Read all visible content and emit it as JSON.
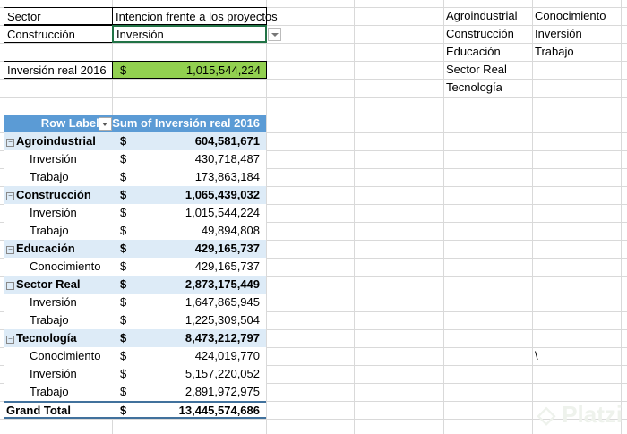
{
  "top": {
    "sector_label": "Sector",
    "intention_label": "Intencion frente a los proyectos",
    "sector_value": "Construcción",
    "intention_value": "Inversión",
    "result_label": "Inversión real 2016",
    "result_currency": "$",
    "result_value": "1,015,544,224"
  },
  "lists": {
    "sectors": [
      "Agroindustrial",
      "Construcción",
      "Educación",
      "Sector Real",
      "Tecnología"
    ],
    "intentions": [
      "Conocimiento",
      "Inversión",
      "Trabajo"
    ]
  },
  "stray_char": "\\",
  "pivot": {
    "header_rows": "Row Labels",
    "header_values": "Sum of Inversión real 2016",
    "rows": [
      {
        "label": "Agroindustrial",
        "currency": "$",
        "value": "604,581,671",
        "type": "group"
      },
      {
        "label": "Inversión",
        "currency": "$",
        "value": "430,718,487",
        "type": "item"
      },
      {
        "label": "Trabajo",
        "currency": "$",
        "value": "173,863,184",
        "type": "item"
      },
      {
        "label": "Construcción",
        "currency": "$",
        "value": "1,065,439,032",
        "type": "group"
      },
      {
        "label": "Inversión",
        "currency": "$",
        "value": "1,015,544,224",
        "type": "item"
      },
      {
        "label": "Trabajo",
        "currency": "$",
        "value": "49,894,808",
        "type": "item"
      },
      {
        "label": "Educación",
        "currency": "$",
        "value": "429,165,737",
        "type": "group"
      },
      {
        "label": "Conocimiento",
        "currency": "$",
        "value": "429,165,737",
        "type": "item"
      },
      {
        "label": "Sector Real",
        "currency": "$",
        "value": "2,873,175,449",
        "type": "group"
      },
      {
        "label": "Inversión",
        "currency": "$",
        "value": "1,647,865,945",
        "type": "item"
      },
      {
        "label": "Trabajo",
        "currency": "$",
        "value": "1,225,309,504",
        "type": "item"
      },
      {
        "label": "Tecnología",
        "currency": "$",
        "value": "8,473,212,797",
        "type": "group"
      },
      {
        "label": "Conocimiento",
        "currency": "$",
        "value": "424,019,770",
        "type": "item"
      },
      {
        "label": "Inversión",
        "currency": "$",
        "value": "5,157,220,052",
        "type": "item"
      },
      {
        "label": "Trabajo",
        "currency": "$",
        "value": "2,891,972,975",
        "type": "item"
      },
      {
        "label": "Grand Total",
        "currency": "$",
        "value": "13,445,574,686",
        "type": "total"
      }
    ]
  },
  "watermark": "Platzi",
  "colors": {
    "pivot_header": "#5b9bd5",
    "pivot_group": "#ddebf7",
    "result_fill": "#92d050",
    "selection": "#217346"
  }
}
